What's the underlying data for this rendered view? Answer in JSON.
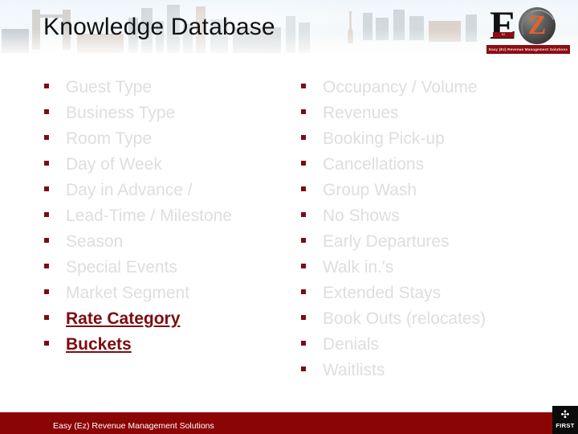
{
  "header": {
    "title": "Knowledge Database",
    "logo": {
      "letter_e": "E",
      "letter_z": "Z",
      "small_band": "EZ",
      "tagline": "Easy (Ez) Revenue Management Solutions"
    }
  },
  "colors": {
    "accent_red": "#7b0d10",
    "footer_red": "#8c0505",
    "muted_text": "#dedede",
    "title_text": "#111111",
    "logo_orange": "#e2622a"
  },
  "content": {
    "left_column": [
      {
        "label": "Guest Type",
        "highlight": false
      },
      {
        "label": "Business Type",
        "highlight": false
      },
      {
        "label": "Room Type",
        "highlight": false
      },
      {
        "label": "Day of Week",
        "highlight": false
      },
      {
        "label": "Day in Advance /",
        "highlight": false
      },
      {
        "label": "Lead-Time / Milestone",
        "highlight": false
      },
      {
        "label": "Season",
        "highlight": false
      },
      {
        "label": "Special Events",
        "highlight": false
      },
      {
        "label": "Market Segment",
        "highlight": false
      },
      {
        "label": "Rate Category",
        "highlight": true
      },
      {
        "label": "Buckets",
        "highlight": true
      }
    ],
    "right_column": [
      {
        "label": "Occupancy / Volume",
        "highlight": false
      },
      {
        "label": "Revenues",
        "highlight": false
      },
      {
        "label": "Booking Pick-up",
        "highlight": false
      },
      {
        "label": "Cancellations",
        "highlight": false
      },
      {
        "label": "Group Wash",
        "highlight": false
      },
      {
        "label": "No Shows",
        "highlight": false
      },
      {
        "label": "Early Departures",
        "highlight": false
      },
      {
        "label": "Walk in.'s",
        "highlight": false
      },
      {
        "label": "Extended Stays",
        "highlight": false
      },
      {
        "label": "Book Outs (relocates)",
        "highlight": false
      },
      {
        "label": "Denials",
        "highlight": false
      },
      {
        "label": "Waitlists",
        "highlight": false
      }
    ]
  },
  "footer": {
    "text": "Easy (Ez) Revenue Management Solutions",
    "first_logo": {
      "bird": "ᾘ5",
      "word": "FIRST"
    }
  }
}
